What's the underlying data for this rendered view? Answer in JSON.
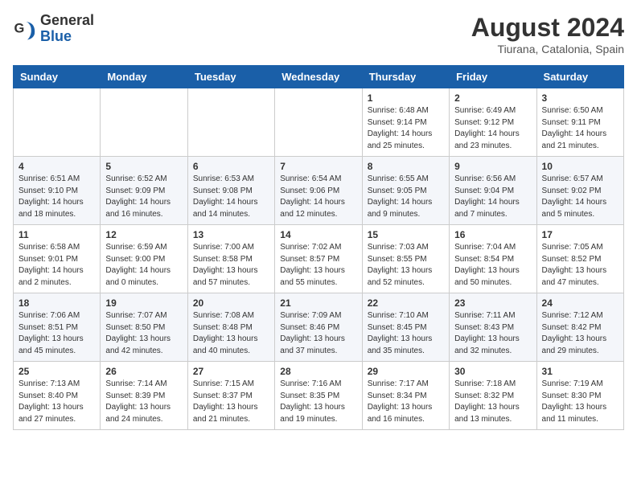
{
  "header": {
    "logo_general": "General",
    "logo_blue": "Blue",
    "month_year": "August 2024",
    "location": "Tiurana, Catalonia, Spain"
  },
  "weekdays": [
    "Sunday",
    "Monday",
    "Tuesday",
    "Wednesday",
    "Thursday",
    "Friday",
    "Saturday"
  ],
  "weeks": [
    [
      {
        "day": null
      },
      {
        "day": null
      },
      {
        "day": null
      },
      {
        "day": null
      },
      {
        "day": 1,
        "sunrise": "6:48 AM",
        "sunset": "9:14 PM",
        "daylight": "14 hours and 25 minutes."
      },
      {
        "day": 2,
        "sunrise": "6:49 AM",
        "sunset": "9:12 PM",
        "daylight": "14 hours and 23 minutes."
      },
      {
        "day": 3,
        "sunrise": "6:50 AM",
        "sunset": "9:11 PM",
        "daylight": "14 hours and 21 minutes."
      }
    ],
    [
      {
        "day": 4,
        "sunrise": "6:51 AM",
        "sunset": "9:10 PM",
        "daylight": "14 hours and 18 minutes."
      },
      {
        "day": 5,
        "sunrise": "6:52 AM",
        "sunset": "9:09 PM",
        "daylight": "14 hours and 16 minutes."
      },
      {
        "day": 6,
        "sunrise": "6:53 AM",
        "sunset": "9:08 PM",
        "daylight": "14 hours and 14 minutes."
      },
      {
        "day": 7,
        "sunrise": "6:54 AM",
        "sunset": "9:06 PM",
        "daylight": "14 hours and 12 minutes."
      },
      {
        "day": 8,
        "sunrise": "6:55 AM",
        "sunset": "9:05 PM",
        "daylight": "14 hours and 9 minutes."
      },
      {
        "day": 9,
        "sunrise": "6:56 AM",
        "sunset": "9:04 PM",
        "daylight": "14 hours and 7 minutes."
      },
      {
        "day": 10,
        "sunrise": "6:57 AM",
        "sunset": "9:02 PM",
        "daylight": "14 hours and 5 minutes."
      }
    ],
    [
      {
        "day": 11,
        "sunrise": "6:58 AM",
        "sunset": "9:01 PM",
        "daylight": "14 hours and 2 minutes."
      },
      {
        "day": 12,
        "sunrise": "6:59 AM",
        "sunset": "9:00 PM",
        "daylight": "14 hours and 0 minutes."
      },
      {
        "day": 13,
        "sunrise": "7:00 AM",
        "sunset": "8:58 PM",
        "daylight": "13 hours and 57 minutes."
      },
      {
        "day": 14,
        "sunrise": "7:02 AM",
        "sunset": "8:57 PM",
        "daylight": "13 hours and 55 minutes."
      },
      {
        "day": 15,
        "sunrise": "7:03 AM",
        "sunset": "8:55 PM",
        "daylight": "13 hours and 52 minutes."
      },
      {
        "day": 16,
        "sunrise": "7:04 AM",
        "sunset": "8:54 PM",
        "daylight": "13 hours and 50 minutes."
      },
      {
        "day": 17,
        "sunrise": "7:05 AM",
        "sunset": "8:52 PM",
        "daylight": "13 hours and 47 minutes."
      }
    ],
    [
      {
        "day": 18,
        "sunrise": "7:06 AM",
        "sunset": "8:51 PM",
        "daylight": "13 hours and 45 minutes."
      },
      {
        "day": 19,
        "sunrise": "7:07 AM",
        "sunset": "8:50 PM",
        "daylight": "13 hours and 42 minutes."
      },
      {
        "day": 20,
        "sunrise": "7:08 AM",
        "sunset": "8:48 PM",
        "daylight": "13 hours and 40 minutes."
      },
      {
        "day": 21,
        "sunrise": "7:09 AM",
        "sunset": "8:46 PM",
        "daylight": "13 hours and 37 minutes."
      },
      {
        "day": 22,
        "sunrise": "7:10 AM",
        "sunset": "8:45 PM",
        "daylight": "13 hours and 35 minutes."
      },
      {
        "day": 23,
        "sunrise": "7:11 AM",
        "sunset": "8:43 PM",
        "daylight": "13 hours and 32 minutes."
      },
      {
        "day": 24,
        "sunrise": "7:12 AM",
        "sunset": "8:42 PM",
        "daylight": "13 hours and 29 minutes."
      }
    ],
    [
      {
        "day": 25,
        "sunrise": "7:13 AM",
        "sunset": "8:40 PM",
        "daylight": "13 hours and 27 minutes."
      },
      {
        "day": 26,
        "sunrise": "7:14 AM",
        "sunset": "8:39 PM",
        "daylight": "13 hours and 24 minutes."
      },
      {
        "day": 27,
        "sunrise": "7:15 AM",
        "sunset": "8:37 PM",
        "daylight": "13 hours and 21 minutes."
      },
      {
        "day": 28,
        "sunrise": "7:16 AM",
        "sunset": "8:35 PM",
        "daylight": "13 hours and 19 minutes."
      },
      {
        "day": 29,
        "sunrise": "7:17 AM",
        "sunset": "8:34 PM",
        "daylight": "13 hours and 16 minutes."
      },
      {
        "day": 30,
        "sunrise": "7:18 AM",
        "sunset": "8:32 PM",
        "daylight": "13 hours and 13 minutes."
      },
      {
        "day": 31,
        "sunrise": "7:19 AM",
        "sunset": "8:30 PM",
        "daylight": "13 hours and 11 minutes."
      }
    ]
  ]
}
